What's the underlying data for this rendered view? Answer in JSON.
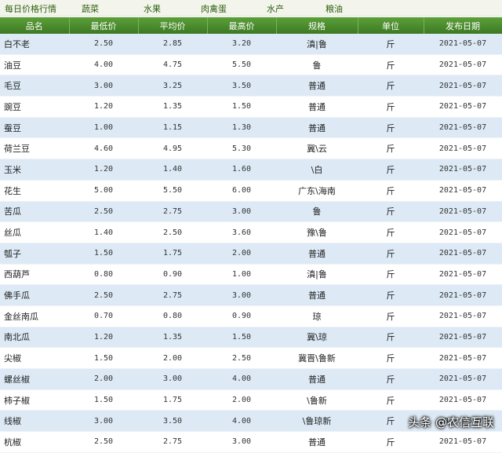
{
  "nav": [
    {
      "label": "每日价格行情"
    },
    {
      "label": "蔬菜"
    },
    {
      "label": "水果"
    },
    {
      "label": "肉禽蛋"
    },
    {
      "label": "水产"
    },
    {
      "label": "粮油"
    }
  ],
  "table": {
    "headers": [
      "品名",
      "最低价",
      "平均价",
      "最高价",
      "规格",
      "单位",
      "发布日期"
    ],
    "rows": [
      [
        "白不老",
        "2.50",
        "2.85",
        "3.20",
        "滇|鲁",
        "斤",
        "2021-05-07"
      ],
      [
        "油豆",
        "4.00",
        "4.75",
        "5.50",
        "鲁",
        "斤",
        "2021-05-07"
      ],
      [
        "毛豆",
        "3.00",
        "3.25",
        "3.50",
        "普通",
        "斤",
        "2021-05-07"
      ],
      [
        "豌豆",
        "1.20",
        "1.35",
        "1.50",
        "普通",
        "斤",
        "2021-05-07"
      ],
      [
        "蚕豆",
        "1.00",
        "1.15",
        "1.30",
        "普通",
        "斤",
        "2021-05-07"
      ],
      [
        "荷兰豆",
        "4.60",
        "4.95",
        "5.30",
        "冀\\云",
        "斤",
        "2021-05-07"
      ],
      [
        "玉米",
        "1.20",
        "1.40",
        "1.60",
        "\\白",
        "斤",
        "2021-05-07"
      ],
      [
        "花生",
        "5.00",
        "5.50",
        "6.00",
        "广东\\海南",
        "斤",
        "2021-05-07"
      ],
      [
        "苦瓜",
        "2.50",
        "2.75",
        "3.00",
        "鲁",
        "斤",
        "2021-05-07"
      ],
      [
        "丝瓜",
        "1.40",
        "2.50",
        "3.60",
        "豫\\鲁",
        "斤",
        "2021-05-07"
      ],
      [
        "瓠子",
        "1.50",
        "1.75",
        "2.00",
        "普通",
        "斤",
        "2021-05-07"
      ],
      [
        "西葫芦",
        "0.80",
        "0.90",
        "1.00",
        "滇|鲁",
        "斤",
        "2021-05-07"
      ],
      [
        "佛手瓜",
        "2.50",
        "2.75",
        "3.00",
        "普通",
        "斤",
        "2021-05-07"
      ],
      [
        "金丝南瓜",
        "0.70",
        "0.80",
        "0.90",
        "琼",
        "斤",
        "2021-05-07"
      ],
      [
        "南北瓜",
        "1.20",
        "1.35",
        "1.50",
        "冀\\琼",
        "斤",
        "2021-05-07"
      ],
      [
        "尖椒",
        "1.50",
        "2.00",
        "2.50",
        "冀晋\\鲁新",
        "斤",
        "2021-05-07"
      ],
      [
        "螺丝椒",
        "2.00",
        "3.00",
        "4.00",
        "普通",
        "斤",
        "2021-05-07"
      ],
      [
        "柿子椒",
        "1.50",
        "1.75",
        "2.00",
        "\\鲁新",
        "斤",
        "2021-05-07"
      ],
      [
        "线椒",
        "3.00",
        "3.50",
        "4.00",
        "\\鲁琼新",
        "斤",
        "2021-05-07"
      ],
      [
        "杭椒",
        "2.50",
        "2.75",
        "3.00",
        "普通",
        "斤",
        "2021-05-07"
      ]
    ]
  },
  "watermark": "头条 @农信互联"
}
